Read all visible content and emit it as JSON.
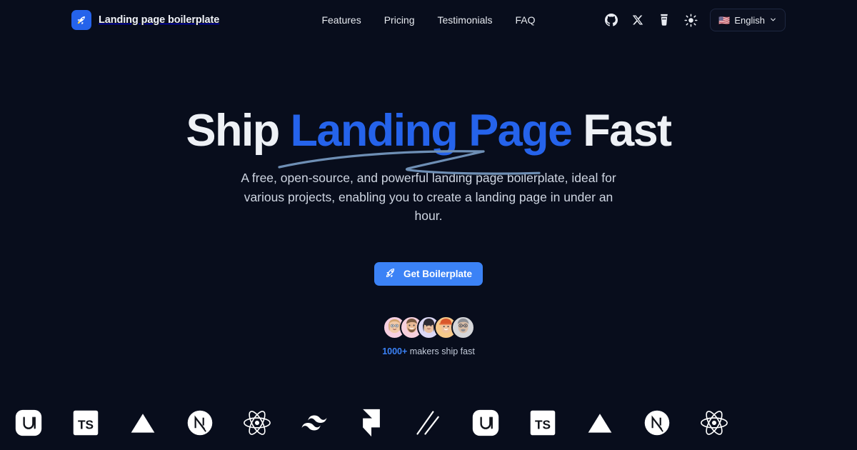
{
  "theme": {
    "background": "#080d1c",
    "accent_blue": "#2563eb",
    "button_blue": "#3b82f6",
    "text_primary": "#eef1f6",
    "text_muted": "#cfd6e2",
    "underline_stroke": "#6e8fb5"
  },
  "header": {
    "brand": {
      "icon": "rocket-icon",
      "name": "Landing page boilerplate"
    },
    "nav": [
      {
        "label": "Features"
      },
      {
        "label": "Pricing"
      },
      {
        "label": "Testimonials"
      },
      {
        "label": "FAQ"
      }
    ],
    "actions": [
      {
        "icon": "github-icon",
        "name": "github-link"
      },
      {
        "icon": "x-twitter-icon",
        "name": "x-twitter-link"
      },
      {
        "icon": "coffee-cup-icon",
        "name": "buy-me-a-coffee-link"
      },
      {
        "icon": "sun-icon",
        "name": "theme-toggle-button"
      }
    ],
    "language": {
      "flag": "🇺🇸",
      "label": "English",
      "chevron": "chevron-down-icon"
    }
  },
  "hero": {
    "headline": {
      "lead": "Ship ",
      "accent": "Landing Page",
      "trail": " Fast"
    },
    "subtitle": "A free, open-source, and powerful landing page boilerplate, ideal for various projects, enabling you to create a landing page in under an hour.",
    "cta": {
      "icon": "rocket-icon",
      "label": "Get Boilerplate"
    },
    "social_proof": {
      "count": "1000+",
      "text": " makers ship fast",
      "avatars": [
        {
          "name": "avatar-1",
          "bg": "#f6cfe0",
          "skin": "#f0c9a8",
          "hair": "#d3a46e"
        },
        {
          "name": "avatar-2",
          "bg": "#f7d0dd",
          "skin": "#e8b894",
          "hair": "#8b6a50"
        },
        {
          "name": "avatar-3",
          "bg": "#dcd8f5",
          "skin": "#e7bfa0",
          "hair": "#2c2a33"
        },
        {
          "name": "avatar-4",
          "bg": "#f6c98a",
          "skin": "#f0c29c",
          "hair": "#c96a3a"
        },
        {
          "name": "avatar-5",
          "bg": "#d5d6d9",
          "skin": "#d8bda6",
          "hair": "#8d8f95"
        }
      ]
    }
  },
  "logo_marquee": [
    {
      "name": "shadcn-ui-logo",
      "icon": "ui"
    },
    {
      "name": "typescript-logo",
      "icon": "ts"
    },
    {
      "name": "vercel-logo",
      "icon": "triangle"
    },
    {
      "name": "nextjs-logo",
      "icon": "next"
    },
    {
      "name": "react-logo",
      "icon": "react"
    },
    {
      "name": "tailwind-logo",
      "icon": "tailwind"
    },
    {
      "name": "framer-logo",
      "icon": "framer"
    },
    {
      "name": "magicui-logo",
      "icon": "slashes"
    },
    {
      "name": "shadcn-ui-logo",
      "icon": "ui"
    },
    {
      "name": "typescript-logo",
      "icon": "ts"
    },
    {
      "name": "vercel-logo",
      "icon": "triangle"
    },
    {
      "name": "nextjs-logo",
      "icon": "next"
    },
    {
      "name": "react-logo",
      "icon": "react"
    }
  ]
}
